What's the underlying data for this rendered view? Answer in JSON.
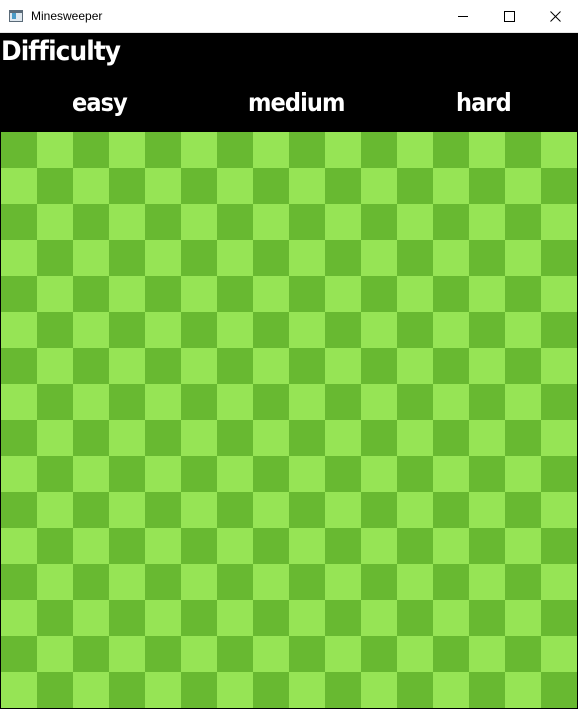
{
  "window": {
    "title": "Minesweeper",
    "icon": "app-window-icon"
  },
  "header": {
    "title": "Difficulty",
    "options": [
      {
        "label": "easy"
      },
      {
        "label": "medium"
      },
      {
        "label": "hard"
      }
    ]
  },
  "board": {
    "rows": 16,
    "cols": 16,
    "colors": {
      "dark": "#68b931",
      "light": "#96e455"
    }
  }
}
